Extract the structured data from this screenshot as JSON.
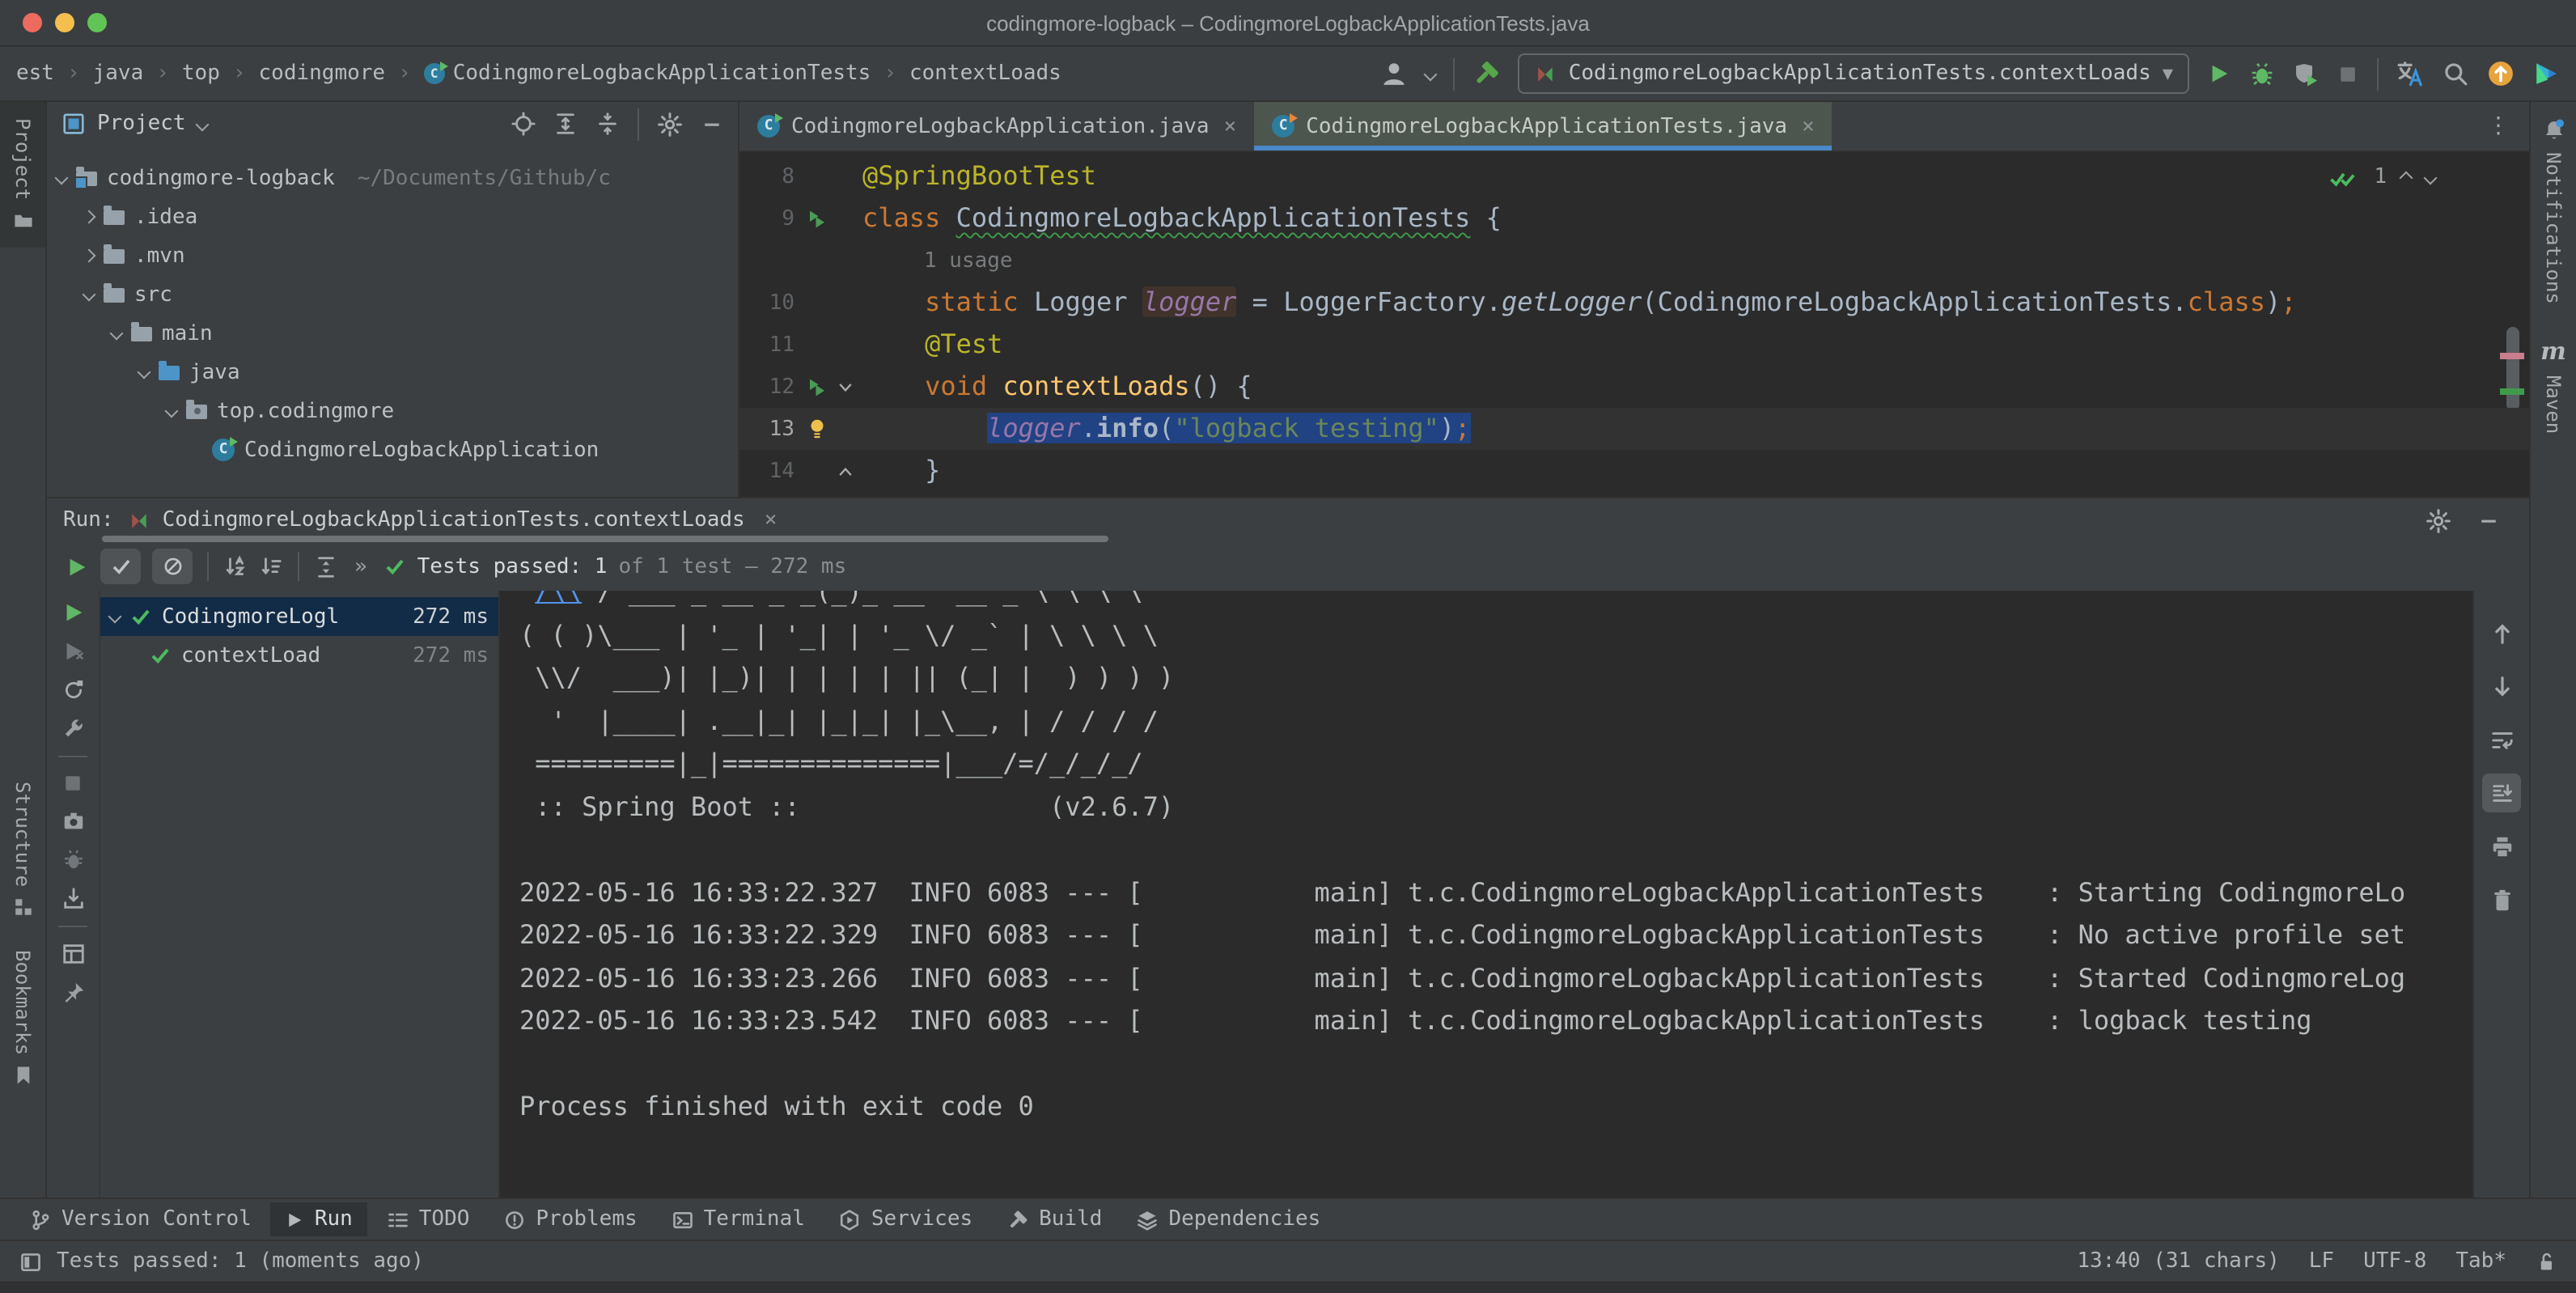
{
  "window": {
    "title": "codingmore-logback – CodingmoreLogbackApplicationTests.java"
  },
  "navbar": {
    "breadcrumbs": [
      {
        "label": "est"
      },
      {
        "label": "java"
      },
      {
        "label": "top"
      },
      {
        "label": "codingmore"
      },
      {
        "label": "CodingmoreLogbackApplicationTests",
        "icon": "class"
      },
      {
        "label": "contextLoads"
      }
    ],
    "run_config": "CodingmoreLogbackApplicationTests.contextLoads"
  },
  "left_stripe": {
    "items": [
      {
        "label": "Project",
        "active": true
      },
      {
        "label": "Structure"
      },
      {
        "label": "Bookmarks"
      }
    ]
  },
  "right_stripe": {
    "items": [
      {
        "label": "Notifications"
      },
      {
        "label": "Maven"
      }
    ],
    "maven_glyph": "m"
  },
  "project": {
    "title": "Project",
    "tree": [
      {
        "label": "codingmore-logback",
        "path": "~/Documents/Github/c",
        "depth": 0,
        "expand": "open",
        "icon": "project"
      },
      {
        "label": ".idea",
        "depth": 1,
        "expand": "closed",
        "icon": "folder"
      },
      {
        "label": ".mvn",
        "depth": 1,
        "expand": "closed",
        "icon": "folder"
      },
      {
        "label": "src",
        "depth": 1,
        "expand": "open",
        "icon": "folder"
      },
      {
        "label": "main",
        "depth": 2,
        "expand": "open",
        "icon": "folder"
      },
      {
        "label": "java",
        "depth": 3,
        "expand": "open",
        "icon": "src"
      },
      {
        "label": "top.codingmore",
        "depth": 4,
        "expand": "open",
        "icon": "package"
      },
      {
        "label": "CodingmoreLogbackApplication",
        "depth": 5,
        "expand": "none",
        "icon": "class-run"
      }
    ]
  },
  "editor": {
    "tabs": [
      {
        "label": "CodingmoreLogbackApplication.java",
        "active": false
      },
      {
        "label": "CodingmoreLogbackApplicationTests.java",
        "active": true
      }
    ],
    "inspections": {
      "count": "1"
    },
    "code": [
      {
        "num": "8",
        "tokens": [
          [
            "@SpringBootTest",
            "ann"
          ]
        ]
      },
      {
        "num": "9",
        "gutter": "run",
        "tokens": [
          [
            "class ",
            "kw"
          ],
          [
            "CodingmoreLogbackApplicationTests",
            "pl wavy"
          ],
          [
            " {",
            "pl"
          ]
        ]
      },
      {
        "num": "",
        "hint": "1 usage"
      },
      {
        "num": "10",
        "tokens": [
          [
            "    ",
            "pl"
          ],
          [
            "static ",
            "kw"
          ],
          [
            "Logger ",
            "pl"
          ],
          [
            "logger",
            "fld hl"
          ],
          [
            " = LoggerFactory.",
            "pl"
          ],
          [
            "getLogger",
            "itc"
          ],
          [
            "(CodingmoreLogbackApplicationTests.",
            "pl"
          ],
          [
            "class",
            "kw"
          ],
          [
            ")",
            "pl"
          ],
          [
            ";",
            "semi"
          ]
        ]
      },
      {
        "num": "11",
        "tokens": [
          [
            "    ",
            "pl"
          ],
          [
            "@Test",
            "ann"
          ]
        ]
      },
      {
        "num": "12",
        "gutter": "run",
        "fold": "down",
        "tokens": [
          [
            "    ",
            "pl"
          ],
          [
            "void ",
            "kw"
          ],
          [
            "contextLoads",
            "mth"
          ],
          [
            "() {",
            "pl"
          ]
        ]
      },
      {
        "num": "13",
        "gutter": "bulb",
        "caret": true,
        "tokens": [
          [
            "        ",
            "pl"
          ],
          [
            "logger",
            "fld sel"
          ],
          [
            ".",
            "pl sel"
          ],
          [
            "info",
            "bold sel"
          ],
          [
            "(",
            "pl sel"
          ],
          [
            "\"logback testing\"",
            "str sel"
          ],
          [
            ")",
            "pl sel"
          ],
          [
            ";",
            "semi sel"
          ]
        ]
      },
      {
        "num": "14",
        "fold": "up",
        "tokens": [
          [
            "    ",
            "pl"
          ],
          [
            "}",
            "pl"
          ]
        ]
      }
    ]
  },
  "run_panel": {
    "label": "Run:",
    "tab": "CodingmoreLogbackApplicationTests.contextLoads",
    "status": {
      "strong": "Tests passed: 1",
      "dim": "of 1 test – 272 ms"
    },
    "tests": [
      {
        "name": "CodingmoreLogl",
        "time": "272 ms",
        "selected": true,
        "expand": true
      },
      {
        "name": "contextLoad",
        "time": "272 ms",
        "selected": false,
        "expand": false
      }
    ],
    "console": [
      [
        [
          " ",
          "con"
        ],
        [
          "/\\\\",
          "lnk"
        ],
        [
          " / ___'_ __ _ _(_)_ __  __ _ \\ \\ \\ \\",
          "con"
        ]
      ],
      [
        [
          "( ( )\\___ | '_ | '_| | '_ \\/ _` | \\ \\ \\ \\",
          "con"
        ]
      ],
      [
        [
          " \\\\/  ___)| |_)| | | | | || (_| |  ) ) ) )",
          "con"
        ]
      ],
      [
        [
          "  '  |____| .__|_| |_|_| |_\\__, | / / / /",
          "con"
        ]
      ],
      [
        [
          " =========|_|==============|___/=/_/_/_/",
          "con"
        ]
      ],
      [
        [
          " :: Spring Boot ::                (v2.6.7)",
          "con"
        ]
      ],
      [
        [
          "",
          "con"
        ]
      ],
      [
        [
          "2022-05-16 16:33:22.327  INFO 6083 --- [           main] t.c.CodingmoreLogbackApplicationTests    : Starting CodingmoreLo",
          "con"
        ]
      ],
      [
        [
          "2022-05-16 16:33:22.329  INFO 6083 --- [           main] t.c.CodingmoreLogbackApplicationTests    : No active profile set",
          "con"
        ]
      ],
      [
        [
          "2022-05-16 16:33:23.266  INFO 6083 --- [           main] t.c.CodingmoreLogbackApplicationTests    : Started CodingmoreLog",
          "con"
        ]
      ],
      [
        [
          "2022-05-16 16:33:23.542  INFO 6083 --- [           main] t.c.CodingmoreLogbackApplicationTests    : logback testing",
          "con"
        ]
      ],
      [
        [
          "",
          "con"
        ]
      ],
      [
        [
          "Process finished with exit code 0",
          "con"
        ]
      ]
    ]
  },
  "bottom_tools": [
    {
      "label": "Version Control",
      "icon": "branch",
      "active": false
    },
    {
      "label": "Run",
      "icon": "playsm",
      "active": true
    },
    {
      "label": "TODO",
      "icon": "todo",
      "active": false
    },
    {
      "label": "Problems",
      "icon": "problems",
      "active": false
    },
    {
      "label": "Terminal",
      "icon": "terminal",
      "active": false
    },
    {
      "label": "Services",
      "icon": "services",
      "active": false
    },
    {
      "label": "Build",
      "icon": "buildgray",
      "active": false
    },
    {
      "label": "Dependencies",
      "icon": "deps",
      "active": false
    }
  ],
  "statusbar": {
    "message": "Tests passed: 1 (moments ago)",
    "position": "13:40 (31 chars)",
    "line_sep": "LF",
    "encoding": "UTF-8",
    "indent": "Tab*"
  },
  "colors": {
    "accent_blue": "#4a88c7",
    "run_green": "#5fb865",
    "test_pass_green": "#4dbb5f",
    "keyword_orange": "#cc7832",
    "string_green": "#6a8759",
    "annotation_yellow": "#bbb529",
    "selection_blue": "#214283",
    "update_orange": "#e8a33d"
  }
}
